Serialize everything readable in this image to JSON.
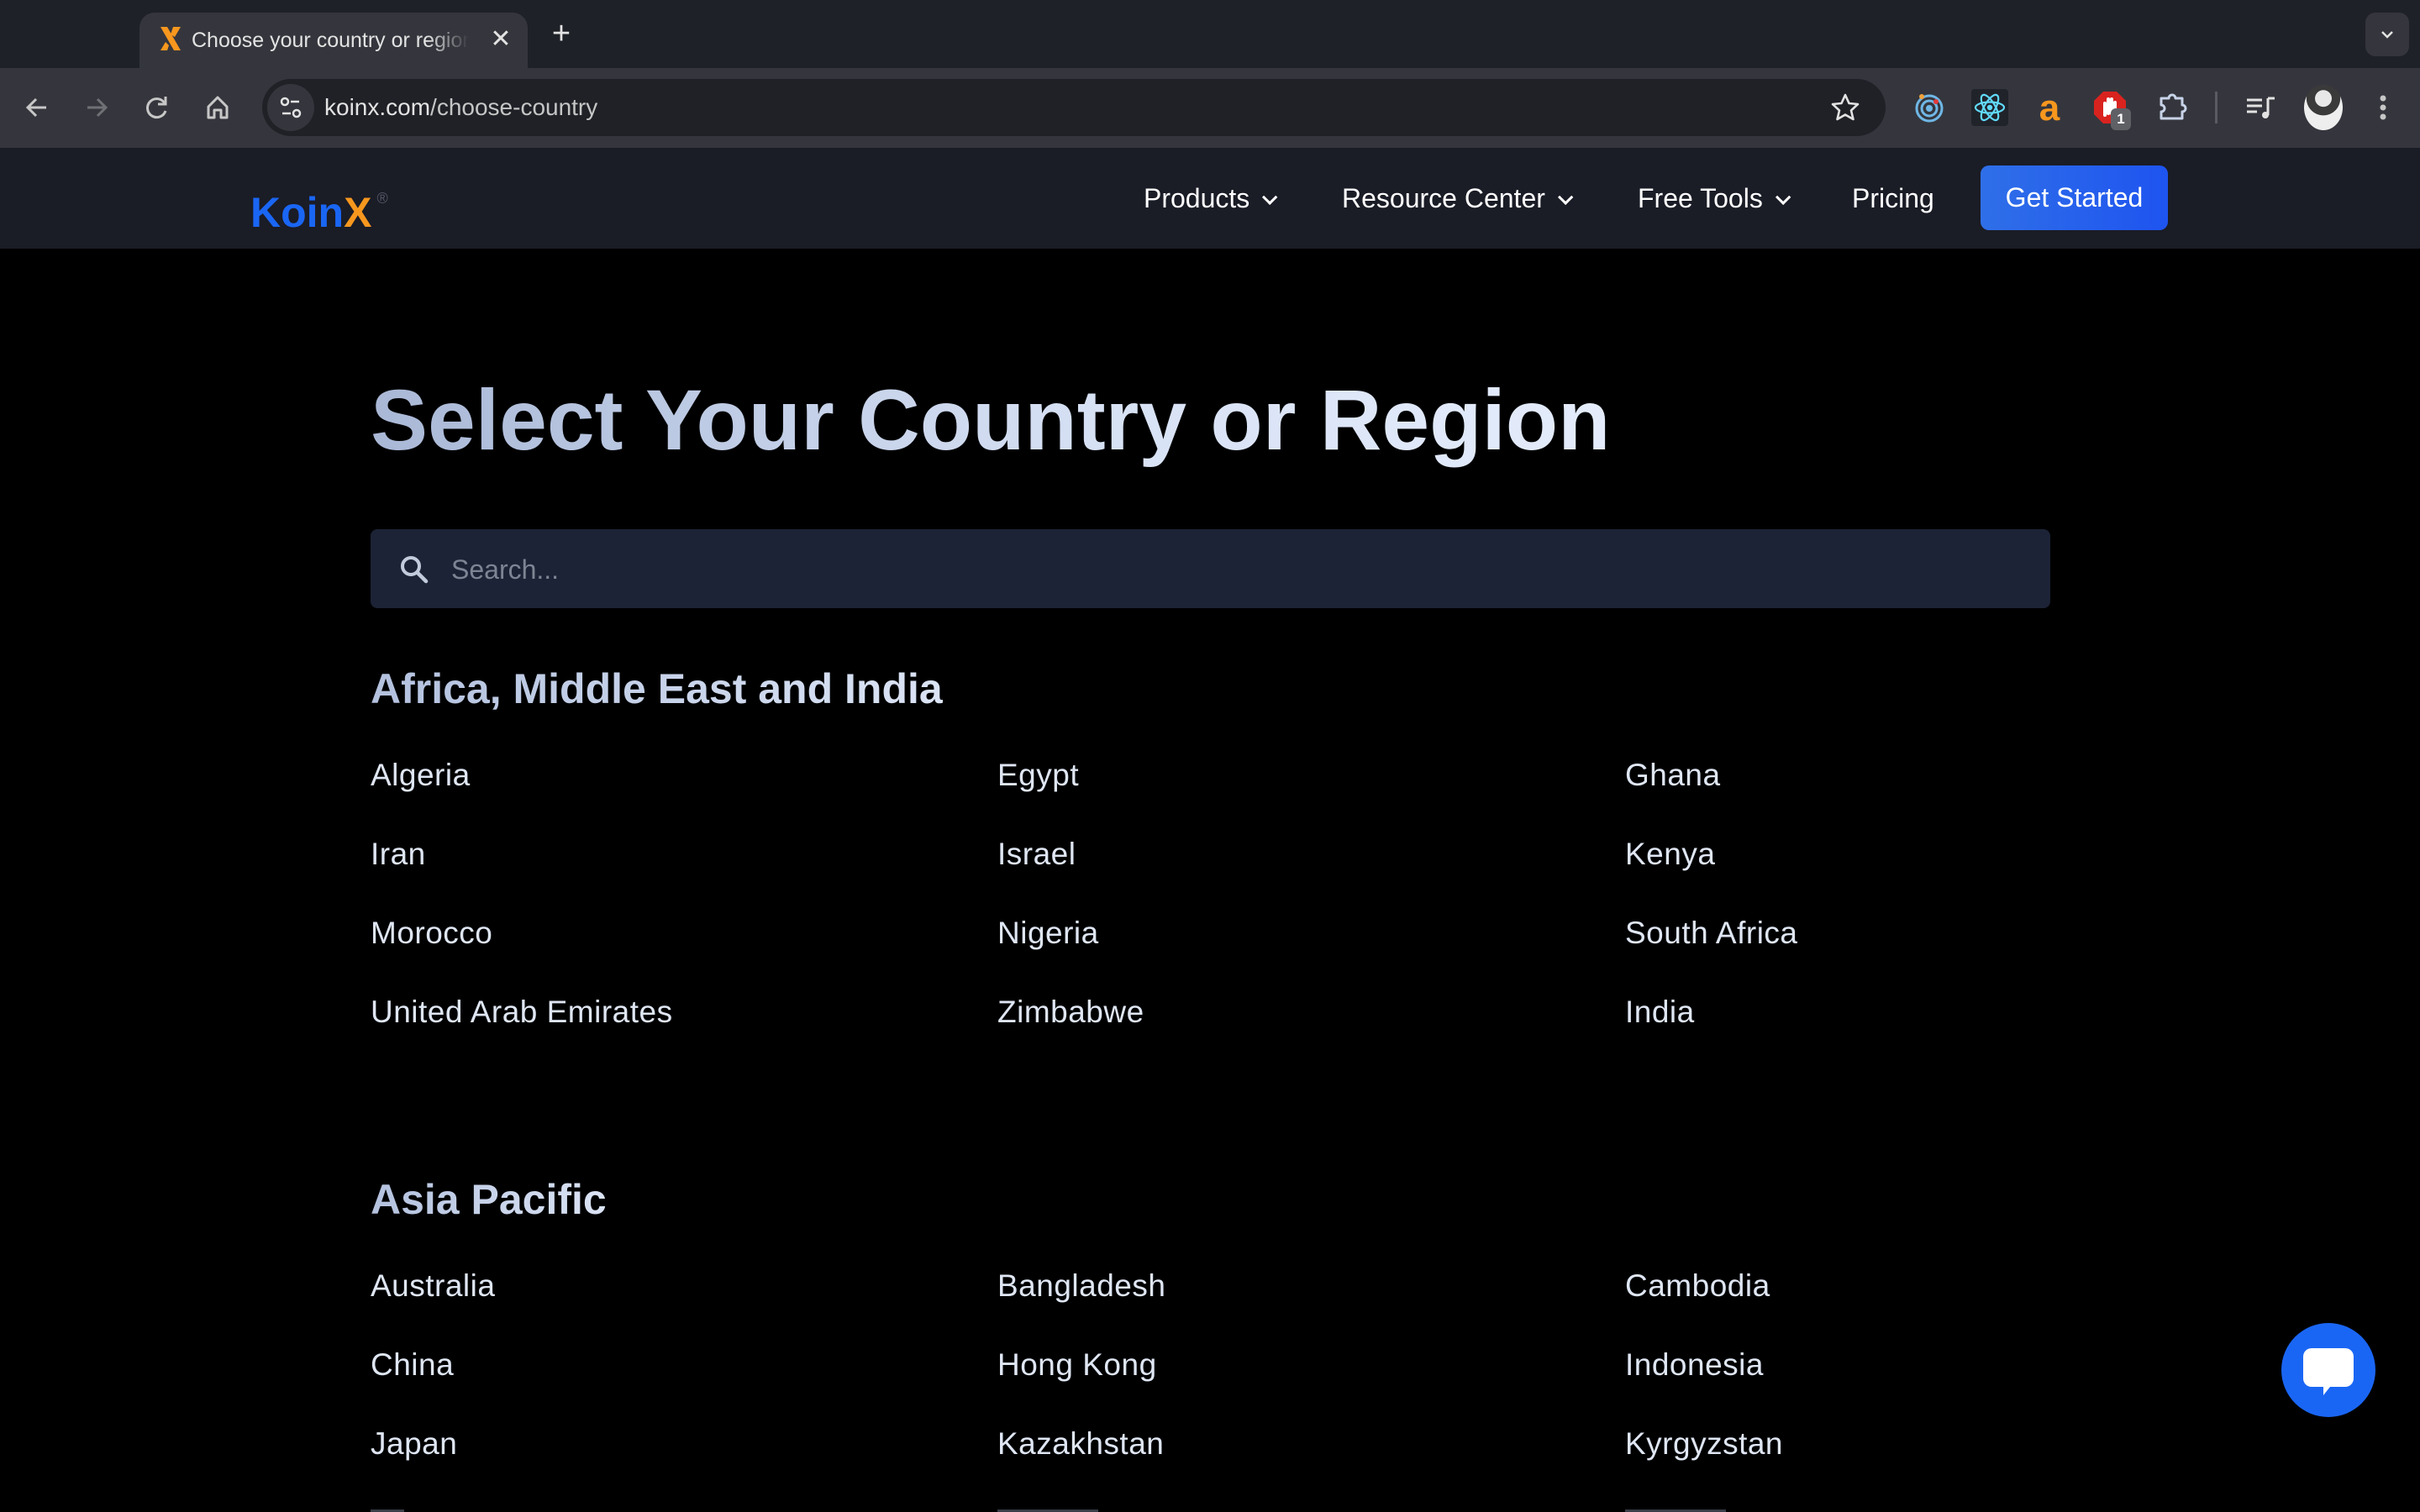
{
  "browser": {
    "tab": {
      "title": "Choose your country or region",
      "close_glyph": "✕"
    },
    "new_tab_glyph": "+",
    "tab_search_glyph": "⌄",
    "url_host": "koinx.com",
    "url_path": "/choose-country",
    "nav_glyphs": {
      "back": "←",
      "forward": "→",
      "reload": "↻",
      "home": "⌂",
      "bookmark": "☆",
      "menu": "⋮"
    },
    "extensions": [
      {
        "name": "orbit-extension-icon"
      },
      {
        "name": "react-devtools-icon"
      },
      {
        "name": "amazon-assistant-icon"
      },
      {
        "name": "adblock-icon",
        "badge": "1"
      },
      {
        "name": "extensions-puzzle-icon"
      }
    ],
    "media_control": "media-control-icon",
    "profile": "profile-avatar"
  },
  "site": {
    "logo_text": {
      "part1": "Koin",
      "part2": "X",
      "registered": "®"
    },
    "nav": [
      {
        "label": "Products",
        "has_dropdown": true
      },
      {
        "label": "Resource Center",
        "has_dropdown": true
      },
      {
        "label": "Free Tools",
        "has_dropdown": true
      },
      {
        "label": "Pricing",
        "has_dropdown": false
      }
    ],
    "cta_label": "Get Started",
    "brand_colors": {
      "blue": "#1a66f4",
      "orange": "#f7971e"
    }
  },
  "main": {
    "title": "Select Your Country or Region",
    "search": {
      "placeholder": "Search...",
      "value": ""
    },
    "regions": [
      {
        "name": "Africa, Middle East and India",
        "countries": [
          "Algeria",
          "Egypt",
          "Ghana",
          "Iran",
          "Israel",
          "Kenya",
          "Morocco",
          "Nigeria",
          "South Africa",
          "United Arab Emirates",
          "Zimbabwe",
          "India"
        ]
      },
      {
        "name": "Asia Pacific",
        "countries": [
          "Australia",
          "Bangladesh",
          "Cambodia",
          "China",
          "Hong Kong",
          "Indonesia",
          "Japan",
          "Kazakhstan",
          "Kyrgyzstan"
        ]
      }
    ]
  },
  "chat_widget": {
    "icon": "chat-bubble-icon"
  }
}
